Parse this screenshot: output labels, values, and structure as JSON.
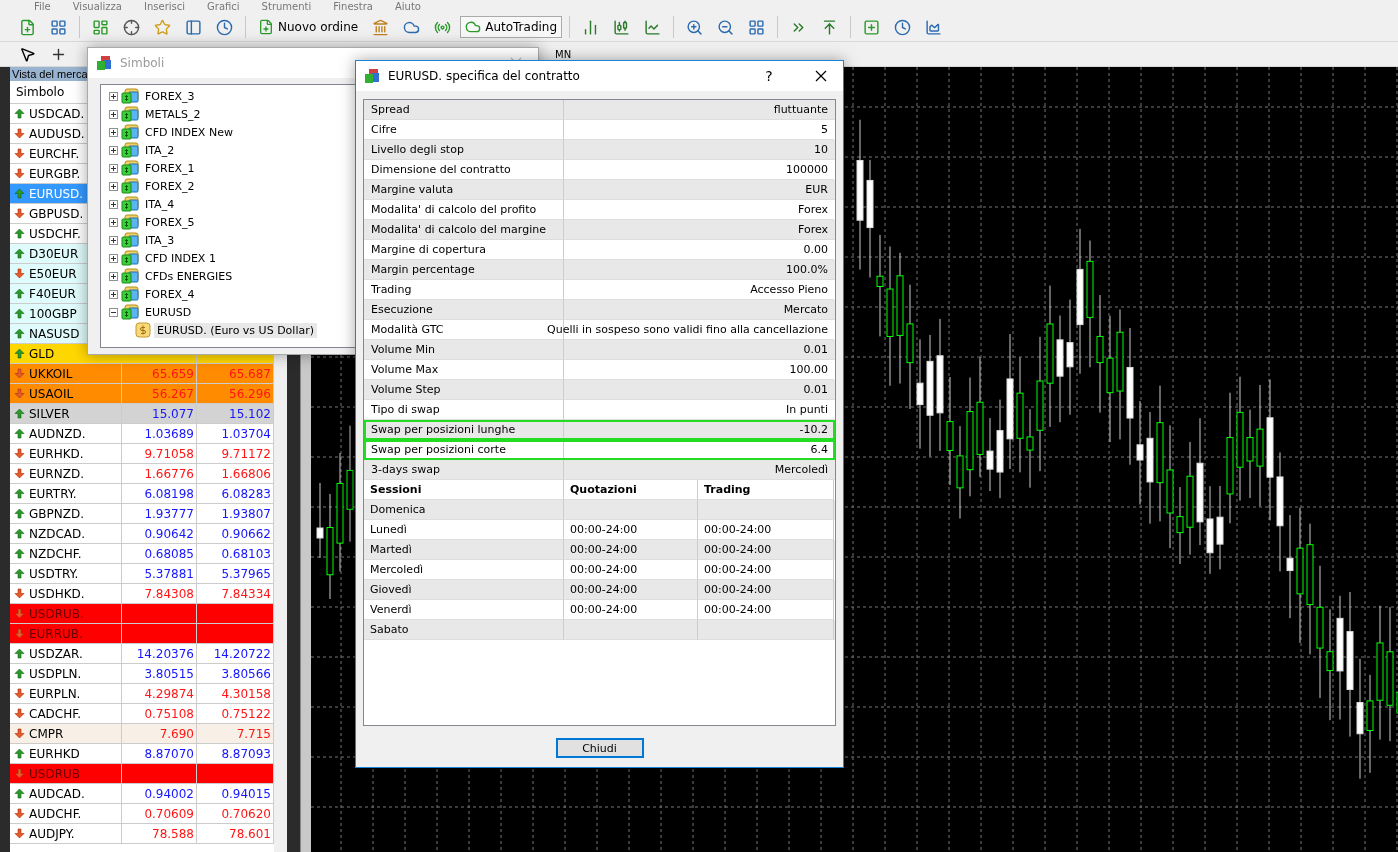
{
  "menu": [
    "File",
    "Visualizza",
    "Inserisci",
    "Grafici",
    "Strumenti",
    "Finestra",
    "Aiuto"
  ],
  "toolbar": {
    "new_order": "Nuovo ordine",
    "autotrading": "AutoTrading"
  },
  "toolbar2": {
    "period": "MN"
  },
  "market_watch": {
    "title": "Vista del merca",
    "column": "Simbolo",
    "rows": [
      {
        "symbol": "USDCAD.",
        "rising": true,
        "selected": false
      },
      {
        "symbol": "AUDUSD.",
        "rising": false,
        "selected": false
      },
      {
        "symbol": "EURCHF.",
        "rising": false,
        "selected": false
      },
      {
        "symbol": "EURGBP.",
        "rising": false,
        "selected": false
      },
      {
        "symbol": "EURUSD.",
        "rising": true,
        "selected": true
      },
      {
        "symbol": "GBPUSD.",
        "rising": false,
        "selected": false
      },
      {
        "symbol": "USDCHF.",
        "rising": true,
        "selected": false
      },
      {
        "symbol": "D30EUR",
        "rising": true,
        "selected": false,
        "color": "#e0fbfb"
      },
      {
        "symbol": "E50EUR",
        "rising": false,
        "selected": false,
        "color": "#e0fbfb"
      },
      {
        "symbol": "F40EUR",
        "rising": true,
        "selected": false,
        "color": "#e0fbfb"
      },
      {
        "symbol": "100GBP",
        "rising": true,
        "selected": false,
        "color": "#e0fbfb"
      },
      {
        "symbol": "NASUSD",
        "rising": true,
        "selected": false,
        "color": "#e0fbfb"
      },
      {
        "symbol": "GLD",
        "rising": true,
        "selected": false,
        "color": "#ffd700"
      },
      {
        "symbol": "UKKOIL",
        "rising": false,
        "bid": "65.659",
        "ask": "65.687",
        "selected": false,
        "color": "#ff8c00"
      },
      {
        "symbol": "USAOIL",
        "rising": false,
        "bid": "56.267",
        "ask": "56.296",
        "selected": false,
        "color": "#ff8c00"
      },
      {
        "symbol": "SILVER",
        "rising": true,
        "bid": "15.077",
        "ask": "15.102",
        "selected": false,
        "color": "#d3d3d3"
      },
      {
        "symbol": "AUDNZD.",
        "rising": true,
        "bid": "1.03689",
        "ask": "1.03704",
        "selected": false
      },
      {
        "symbol": "EURHKD.",
        "rising": false,
        "bid": "9.71058",
        "ask": "9.71172",
        "selected": false
      },
      {
        "symbol": "EURNZD.",
        "rising": false,
        "bid": "1.66776",
        "ask": "1.66806",
        "selected": false
      },
      {
        "symbol": "EURTRY.",
        "rising": true,
        "bid": "6.08198",
        "ask": "6.08283",
        "selected": false
      },
      {
        "symbol": "GBPNZD.",
        "rising": true,
        "bid": "1.93777",
        "ask": "1.93807",
        "selected": false
      },
      {
        "symbol": "NZDCAD.",
        "rising": true,
        "bid": "0.90642",
        "ask": "0.90662",
        "selected": false
      },
      {
        "symbol": "NZDCHF.",
        "rising": true,
        "bid": "0.68085",
        "ask": "0.68103",
        "selected": false
      },
      {
        "symbol": "USDTRY.",
        "rising": true,
        "bid": "5.37881",
        "ask": "5.37965",
        "selected": false
      },
      {
        "symbol": "USDHKD.",
        "rising": false,
        "bid": "7.84308",
        "ask": "7.84334",
        "selected": false
      },
      {
        "symbol": "USDRUB.",
        "rising": false,
        "selected": false,
        "color": "#ff0000"
      },
      {
        "symbol": "EURRUB.",
        "rising": false,
        "selected": false,
        "color": "#ff0000"
      },
      {
        "symbol": "USDZAR.",
        "rising": true,
        "bid": "14.20376",
        "ask": "14.20722",
        "selected": false
      },
      {
        "symbol": "USDPLN.",
        "rising": true,
        "bid": "3.80515",
        "ask": "3.80566",
        "selected": false
      },
      {
        "symbol": "EURPLN.",
        "rising": false,
        "bid": "4.29874",
        "ask": "4.30158",
        "selected": false
      },
      {
        "symbol": "CADCHF.",
        "rising": false,
        "bid": "0.75108",
        "ask": "0.75122",
        "selected": false
      },
      {
        "symbol": "CMPR",
        "rising": false,
        "bid": "7.690",
        "ask": "7.715",
        "selected": false,
        "color": "#f8efe6"
      },
      {
        "symbol": "EURHKD",
        "rising": true,
        "bid": "8.87070",
        "ask": "8.87093",
        "selected": false
      },
      {
        "symbol": "USDRUB",
        "rising": false,
        "selected": false,
        "color": "#ff0000"
      },
      {
        "symbol": "AUDCAD.",
        "rising": true,
        "bid": "0.94002",
        "ask": "0.94015",
        "selected": false
      },
      {
        "symbol": "AUDCHF.",
        "rising": false,
        "bid": "0.70609",
        "ask": "0.70620",
        "selected": false
      },
      {
        "symbol": "AUDJPY.",
        "rising": false,
        "bid": "78.588",
        "ask": "78.601",
        "selected": false
      }
    ]
  },
  "symbols_dialog": {
    "title": "Simboli",
    "tree": [
      {
        "label": "FOREX_3",
        "expanded": false
      },
      {
        "label": "METALS_2",
        "expanded": false
      },
      {
        "label": "CFD INDEX New",
        "expanded": false
      },
      {
        "label": "ITA_2",
        "expanded": false
      },
      {
        "label": "FOREX_1",
        "expanded": false
      },
      {
        "label": "FOREX_2",
        "expanded": false
      },
      {
        "label": "ITA_4",
        "expanded": false
      },
      {
        "label": "FOREX_5",
        "expanded": false
      },
      {
        "label": "ITA_3",
        "expanded": false
      },
      {
        "label": "CFD INDEX 1",
        "expanded": false
      },
      {
        "label": "CFDs ENERGIES",
        "expanded": false
      },
      {
        "label": "FOREX_4",
        "expanded": false
      },
      {
        "label": "EURUSD",
        "expanded": true,
        "children": [
          {
            "label": "EURUSD.  (Euro vs US Dollar)",
            "selected": true
          }
        ]
      }
    ]
  },
  "contract_dialog": {
    "title": "EURUSD. specifica del contratto",
    "help": "?",
    "spec": [
      {
        "label": "Spread",
        "value": "fluttuante",
        "highlighted": false
      },
      {
        "label": "Cifre",
        "value": "5",
        "highlighted": false
      },
      {
        "label": "Livello degli stop",
        "value": "10",
        "highlighted": false
      },
      {
        "label": "Dimensione del contratto",
        "value": "100000",
        "highlighted": false
      },
      {
        "label": "Margine valuta",
        "value": "EUR",
        "highlighted": false
      },
      {
        "label": "Modalita' di calcolo del profito",
        "value": "Forex",
        "highlighted": false
      },
      {
        "label": "Modalita' di calcolo del margine",
        "value": "Forex",
        "highlighted": false
      },
      {
        "label": "Margine di copertura",
        "value": "0.00",
        "highlighted": false
      },
      {
        "label": "Margin percentage",
        "value": "100.0%",
        "highlighted": false
      },
      {
        "label": "Trading",
        "value": "Accesso Pieno",
        "highlighted": false
      },
      {
        "label": "Esecuzione",
        "value": "Mercato",
        "highlighted": false
      },
      {
        "label": "Modalità GTC",
        "value": "Quelli in sospeso sono validi fino alla cancellazione",
        "highlighted": false
      },
      {
        "label": "Volume Min",
        "value": "0.01",
        "highlighted": false
      },
      {
        "label": "Volume Max",
        "value": "100.00",
        "highlighted": false
      },
      {
        "label": "Volume Step",
        "value": "0.01",
        "highlighted": false
      },
      {
        "label": "Tipo di swap",
        "value": "In punti",
        "highlighted": false
      },
      {
        "label": "Swap per posizioni lunghe",
        "value": "-10.2",
        "highlighted": true
      },
      {
        "label": "Swap per posizioni corte",
        "value": "6.4",
        "highlighted": true
      },
      {
        "label": "3-days swap",
        "value": "Mercoledì",
        "highlighted": false
      }
    ],
    "sessions": {
      "columns": [
        "Sessioni",
        "Quotazioni",
        "Trading"
      ],
      "rows": [
        {
          "day": "Domenica"
        },
        {
          "day": "Lunedì",
          "quotes": "00:00-24:00",
          "trading": "00:00-24:00"
        },
        {
          "day": "Martedì",
          "quotes": "00:00-24:00",
          "trading": "00:00-24:00"
        },
        {
          "day": "Mercoledì",
          "quotes": "00:00-24:00",
          "trading": "00:00-24:00"
        },
        {
          "day": "Giovedì",
          "quotes": "00:00-24:00",
          "trading": "00:00-24:00"
        },
        {
          "day": "Venerdì",
          "quotes": "00:00-24:00",
          "trading": "00:00-24:00"
        },
        {
          "day": "Sabato"
        }
      ]
    },
    "close_button": "Chiudi"
  }
}
